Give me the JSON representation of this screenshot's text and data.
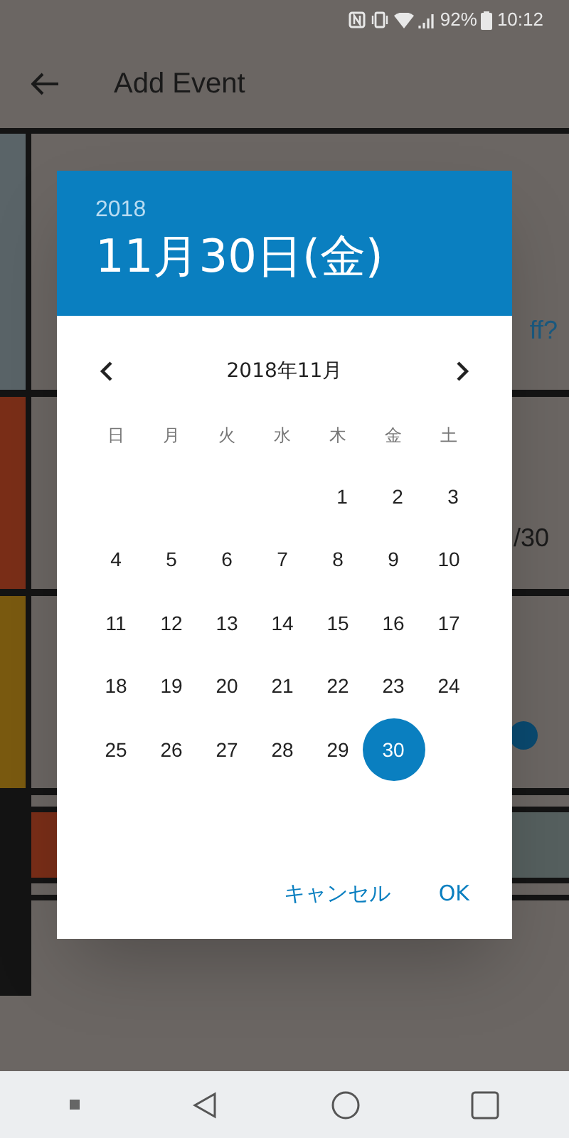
{
  "status_bar": {
    "battery": "92%",
    "time": "10:12"
  },
  "app_bar": {
    "title": "Add Event"
  },
  "background_fragments": {
    "row_1_link": "ff?",
    "row_2_value": "/30"
  },
  "date_dialog": {
    "year": "2018",
    "date": "11月30日(金)",
    "month": "2018年11月",
    "weekdays": [
      "日",
      "月",
      "火",
      "水",
      "木",
      "金",
      "土"
    ],
    "weeks": [
      [
        {
          "day": "1",
          "selected": false
        },
        {
          "day": "2",
          "selected": false
        },
        {
          "day": "3",
          "selected": false
        }
      ],
      [
        {
          "day": "4",
          "selected": false
        },
        {
          "day": "5",
          "selected": false
        },
        {
          "day": "6",
          "selected": false
        },
        {
          "day": "7",
          "selected": false
        },
        {
          "day": "8",
          "selected": false
        },
        {
          "day": "9",
          "selected": false
        },
        {
          "day": "10",
          "selected": false
        }
      ],
      [
        {
          "day": "11",
          "selected": false
        },
        {
          "day": "12",
          "selected": false
        },
        {
          "day": "13",
          "selected": false
        },
        {
          "day": "14",
          "selected": false
        },
        {
          "day": "15",
          "selected": false
        },
        {
          "day": "16",
          "selected": false
        },
        {
          "day": "17",
          "selected": false
        }
      ],
      [
        {
          "day": "18",
          "selected": false
        },
        {
          "day": "19",
          "selected": false
        },
        {
          "day": "20",
          "selected": false
        },
        {
          "day": "21",
          "selected": false
        },
        {
          "day": "22",
          "selected": false
        },
        {
          "day": "23",
          "selected": false
        },
        {
          "day": "24",
          "selected": false
        }
      ],
      [
        {
          "day": "25",
          "selected": false
        },
        {
          "day": "26",
          "selected": false
        },
        {
          "day": "27",
          "selected": false
        },
        {
          "day": "28",
          "selected": false
        },
        {
          "day": "29",
          "selected": false
        },
        {
          "day": "30",
          "selected": true
        }
      ]
    ],
    "buttons": [
      "キャンセル",
      "OK"
    ]
  }
}
